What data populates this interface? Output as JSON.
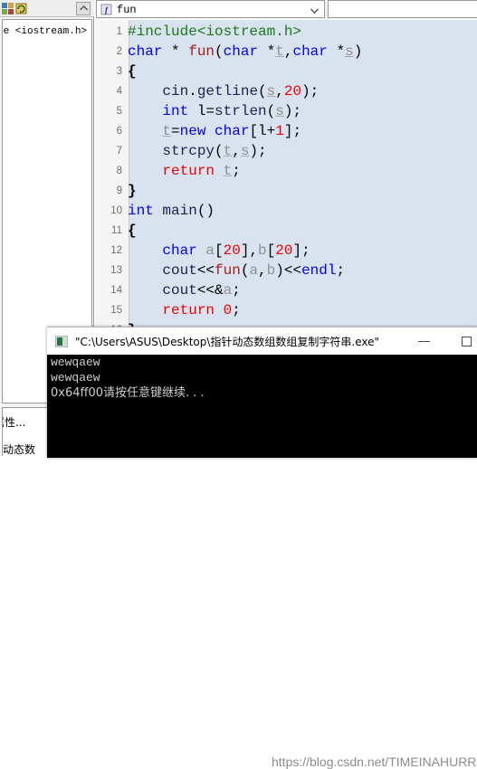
{
  "left_panel": {
    "tree_text": "de <iostream.h>",
    "footer_line1": "属性...",
    "footer_line2": "针动态数",
    "collapse_icon": "chevron-up-icon",
    "toolbar_icons": [
      "class-view-icon",
      "refresh-icon"
    ]
  },
  "nav_bar": {
    "function_combo": {
      "icon": "function-icon",
      "value": "fun",
      "arrow_icon": "chevron-down-icon"
    },
    "scope_combo": {
      "value": ""
    }
  },
  "editor": {
    "lines": [
      {
        "n": "1",
        "tokens": [
          {
            "t": "#include<iostream.h>",
            "c": "pre"
          }
        ]
      },
      {
        "n": "2",
        "tokens": [
          {
            "t": "char",
            "c": "kw"
          },
          {
            "t": " * ",
            "c": "pun"
          },
          {
            "t": "fun",
            "c": "fn"
          },
          {
            "t": "(",
            "c": "pun"
          },
          {
            "t": "char",
            "c": "kw"
          },
          {
            "t": " *",
            "c": "pun"
          },
          {
            "t": "t",
            "c": "var"
          },
          {
            "t": ",",
            "c": "pun"
          },
          {
            "t": "char",
            "c": "kw"
          },
          {
            "t": " *",
            "c": "pun"
          },
          {
            "t": "s",
            "c": "var"
          },
          {
            "t": ")",
            "c": "pun"
          }
        ]
      },
      {
        "n": "3",
        "tokens": [
          {
            "t": "{",
            "c": "brc"
          }
        ]
      },
      {
        "n": "4",
        "tokens": [
          {
            "t": "    ",
            "c": "pun"
          },
          {
            "t": "cin",
            "c": "id"
          },
          {
            "t": ".",
            "c": "pun"
          },
          {
            "t": "getline",
            "c": "id"
          },
          {
            "t": "(",
            "c": "pun"
          },
          {
            "t": "s",
            "c": "var"
          },
          {
            "t": ",",
            "c": "pun"
          },
          {
            "t": "20",
            "c": "num"
          },
          {
            "t": ");",
            "c": "pun"
          }
        ]
      },
      {
        "n": "5",
        "tokens": [
          {
            "t": "    ",
            "c": "pun"
          },
          {
            "t": "int",
            "c": "kw"
          },
          {
            "t": " l=",
            "c": "pun"
          },
          {
            "t": "strlen",
            "c": "id"
          },
          {
            "t": "(",
            "c": "pun"
          },
          {
            "t": "s",
            "c": "var"
          },
          {
            "t": ");",
            "c": "pun"
          }
        ]
      },
      {
        "n": "6",
        "tokens": [
          {
            "t": "    ",
            "c": "pun"
          },
          {
            "t": "t",
            "c": "var"
          },
          {
            "t": "=",
            "c": "pun"
          },
          {
            "t": "new",
            "c": "kw"
          },
          {
            "t": " ",
            "c": "pun"
          },
          {
            "t": "char",
            "c": "kw"
          },
          {
            "t": "[l+",
            "c": "pun"
          },
          {
            "t": "1",
            "c": "num"
          },
          {
            "t": "];",
            "c": "pun"
          }
        ]
      },
      {
        "n": "7",
        "tokens": [
          {
            "t": "    ",
            "c": "pun"
          },
          {
            "t": "strcpy",
            "c": "id"
          },
          {
            "t": "(",
            "c": "pun"
          },
          {
            "t": "t",
            "c": "var"
          },
          {
            "t": ",",
            "c": "pun"
          },
          {
            "t": "s",
            "c": "var"
          },
          {
            "t": ");",
            "c": "pun"
          }
        ]
      },
      {
        "n": "8",
        "tokens": [
          {
            "t": "    ",
            "c": "pun"
          },
          {
            "t": "return",
            "c": "num"
          },
          {
            "t": " ",
            "c": "pun"
          },
          {
            "t": "t",
            "c": "var"
          },
          {
            "t": ";",
            "c": "pun"
          }
        ]
      },
      {
        "n": "9",
        "tokens": [
          {
            "t": "}",
            "c": "brc"
          }
        ]
      },
      {
        "n": "10",
        "tokens": [
          {
            "t": "int",
            "c": "kw"
          },
          {
            "t": " ",
            "c": "pun"
          },
          {
            "t": "main",
            "c": "id"
          },
          {
            "t": "()",
            "c": "pun"
          }
        ]
      },
      {
        "n": "11",
        "tokens": [
          {
            "t": "{",
            "c": "brc"
          }
        ]
      },
      {
        "n": "12",
        "tokens": [
          {
            "t": "    ",
            "c": "pun"
          },
          {
            "t": "char",
            "c": "kw"
          },
          {
            "t": " ",
            "c": "pun"
          },
          {
            "t": "a",
            "c": "var2"
          },
          {
            "t": "[",
            "c": "pun"
          },
          {
            "t": "20",
            "c": "num"
          },
          {
            "t": "],",
            "c": "pun"
          },
          {
            "t": "b",
            "c": "var2"
          },
          {
            "t": "[",
            "c": "pun"
          },
          {
            "t": "20",
            "c": "num"
          },
          {
            "t": "];",
            "c": "pun"
          }
        ]
      },
      {
        "n": "13",
        "tokens": [
          {
            "t": "    ",
            "c": "pun"
          },
          {
            "t": "cout",
            "c": "id"
          },
          {
            "t": "<<",
            "c": "pun"
          },
          {
            "t": "fun",
            "c": "fn"
          },
          {
            "t": "(",
            "c": "pun"
          },
          {
            "t": "a",
            "c": "var2"
          },
          {
            "t": ",",
            "c": "pun"
          },
          {
            "t": "b",
            "c": "var2"
          },
          {
            "t": ")<<",
            "c": "pun"
          },
          {
            "t": "endl",
            "c": "kw"
          },
          {
            "t": ";",
            "c": "pun"
          }
        ]
      },
      {
        "n": "14",
        "tokens": [
          {
            "t": "    ",
            "c": "pun"
          },
          {
            "t": "cout",
            "c": "id"
          },
          {
            "t": "<<&",
            "c": "pun"
          },
          {
            "t": "a",
            "c": "var2"
          },
          {
            "t": ";",
            "c": "pun"
          }
        ]
      },
      {
        "n": "15",
        "tokens": [
          {
            "t": "    ",
            "c": "pun"
          },
          {
            "t": "return",
            "c": "num"
          },
          {
            "t": " ",
            "c": "pun"
          },
          {
            "t": "0",
            "c": "num"
          },
          {
            "t": ";",
            "c": "pun"
          }
        ]
      },
      {
        "n": "16",
        "tokens": [
          {
            "t": "}",
            "c": "brc"
          }
        ]
      }
    ]
  },
  "console": {
    "title": "\"C:\\Users\\ASUS\\Desktop\\指针动态数组数组复制字符串.exe\"",
    "icon": "console-app-icon",
    "minimize_label": "minimize-icon",
    "maximize_label": "maximize-icon",
    "output": [
      "wewqaew",
      "wewqaew",
      "0x64ff00请按任意键继续. . ."
    ]
  },
  "watermark": {
    "text": "https://blog.csdn.net/TIMEINAHURRY"
  },
  "colors": {
    "editor_bg": "#d9e3f0",
    "gutter_bg": "#f5f5f5",
    "keyword": "#0000ff",
    "function": "#a52019",
    "number": "#ee0000",
    "preprocessor": "#1a7a1a",
    "console_bg": "#000000",
    "console_fg": "#cccccc"
  }
}
